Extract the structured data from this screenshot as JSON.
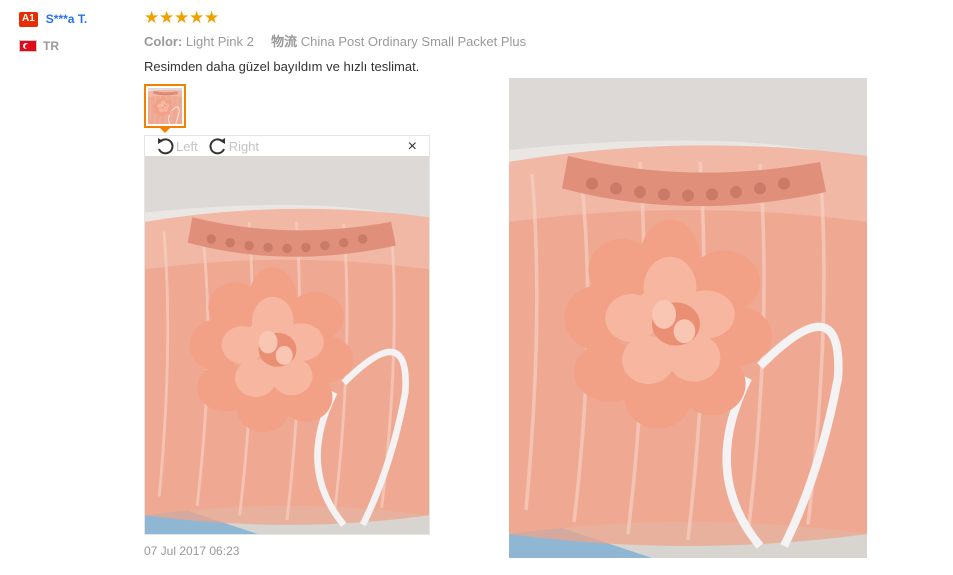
{
  "reviewer": {
    "level_badge": "A1",
    "name": "S***a T.",
    "country_code": "TR",
    "flag_icon": "turkey-flag-icon"
  },
  "rating": {
    "stars": 5,
    "max": 5,
    "color": "#f2a000"
  },
  "attributes": {
    "color_key": "Color:",
    "color_value": "Light Pink 2",
    "shipping_key": "物流",
    "shipping_value": "China Post Ordinary Small Packet Plus"
  },
  "review_text": "Resimden daha güzel bayıldım ve hızlı teslimat.",
  "viewer": {
    "rotate_left_label": "Left",
    "rotate_right_label": "Right",
    "close_label": "×"
  },
  "date": "07 Jul 2017 06:23",
  "colors": {
    "accent": "#f08200",
    "username": "#2672ec",
    "badge": "#e62e04"
  }
}
